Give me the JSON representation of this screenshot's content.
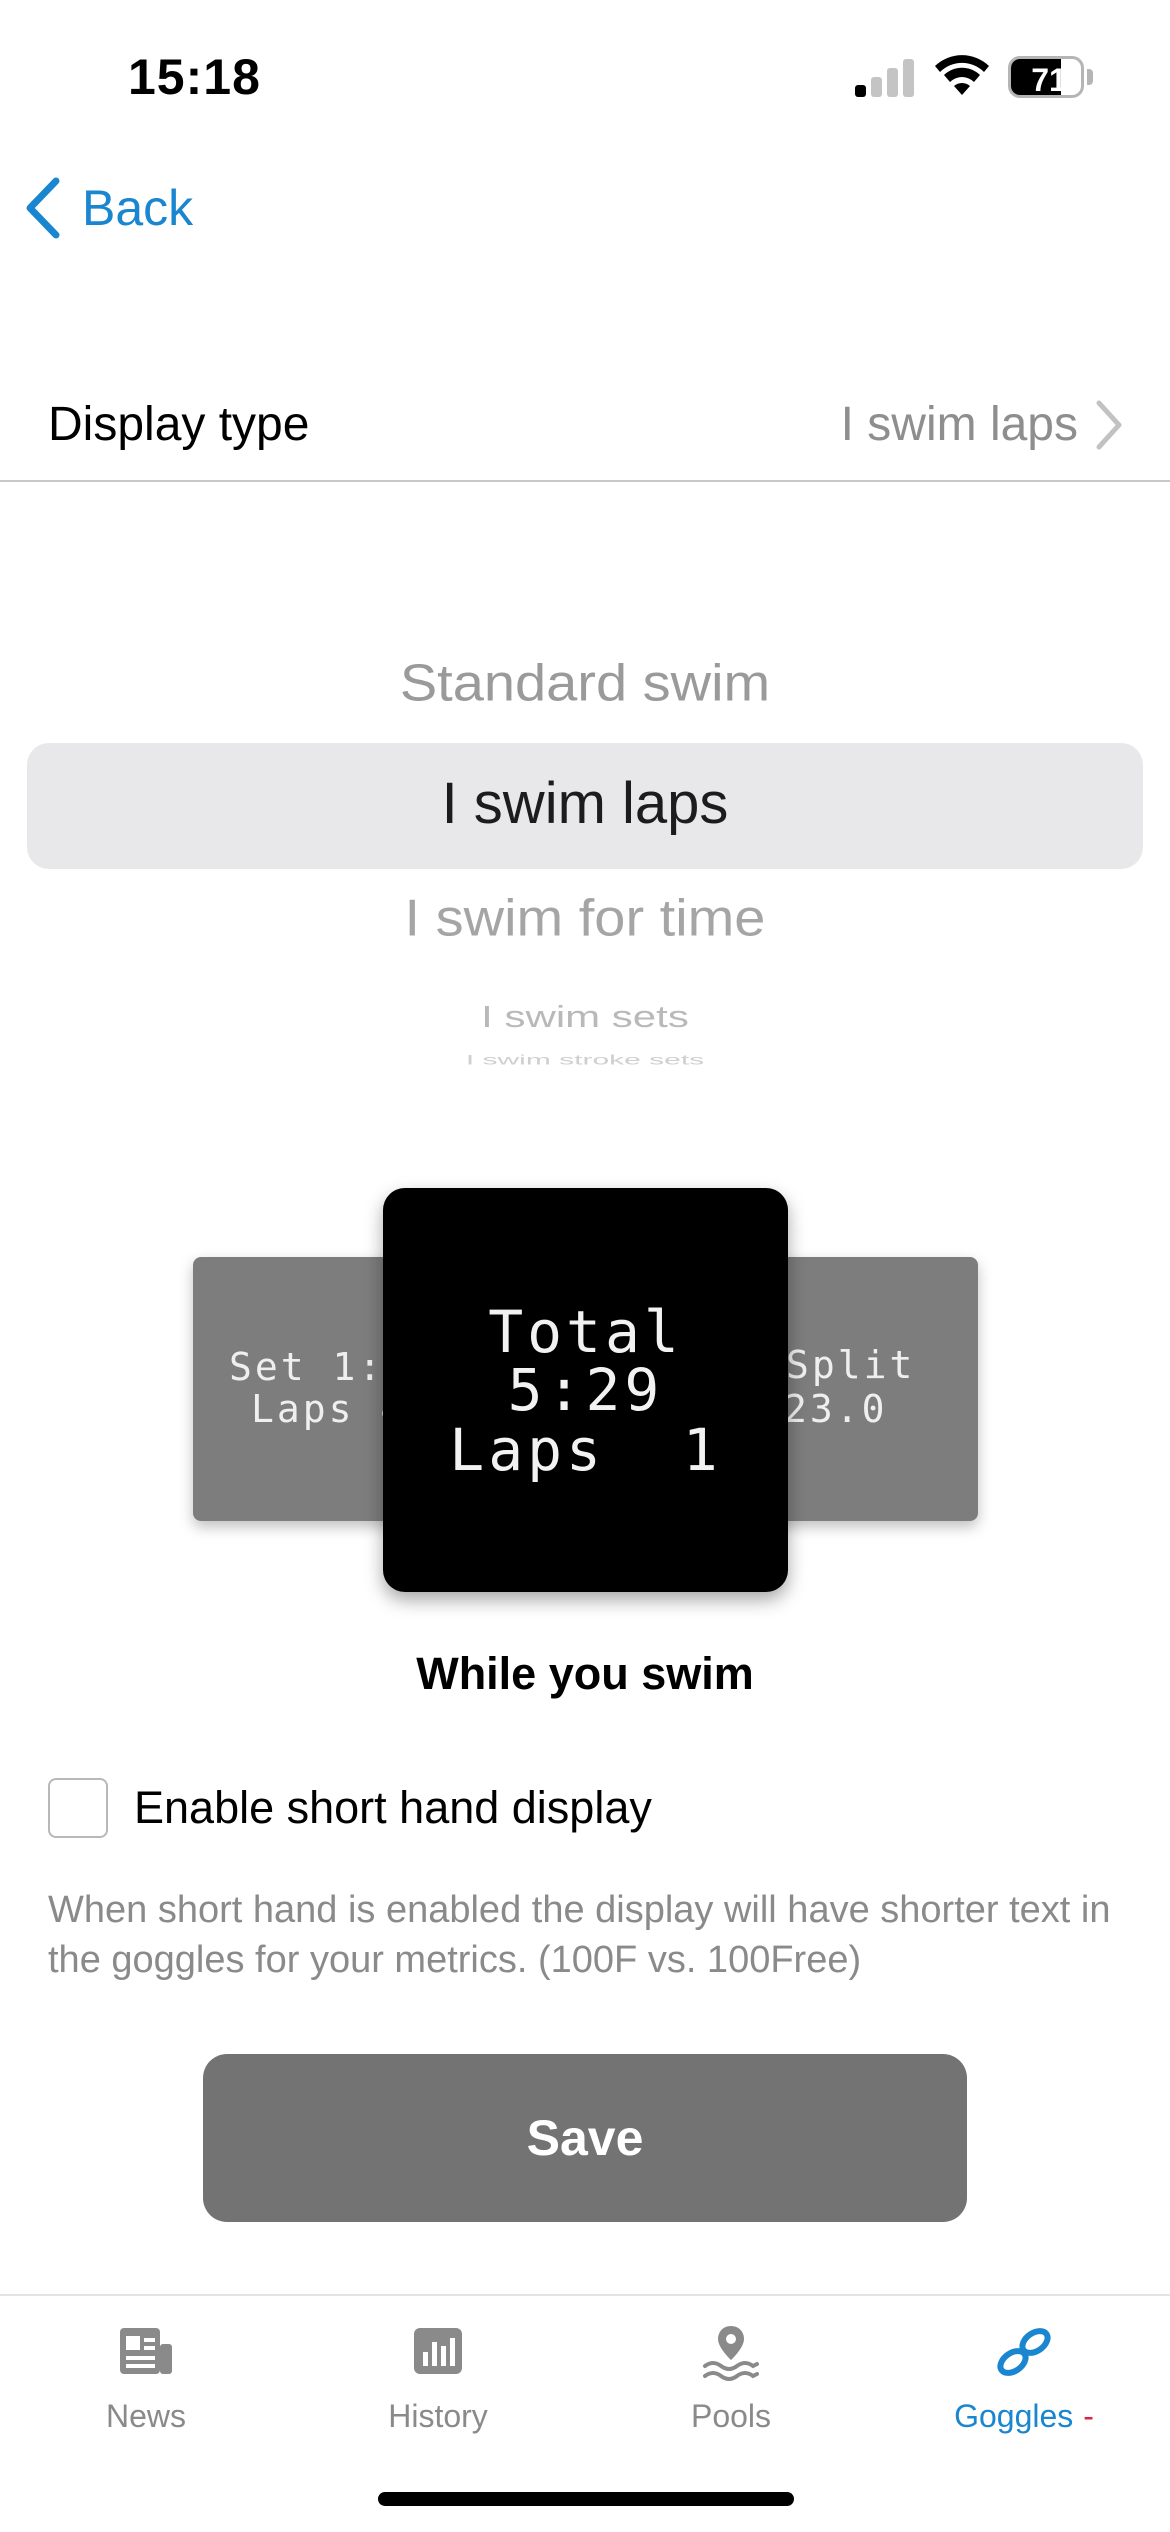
{
  "status_bar": {
    "time": "15:18",
    "battery": "71",
    "battery_level": 0.71
  },
  "nav": {
    "back_label": "Back"
  },
  "settings_row": {
    "label": "Display type",
    "value": "I swim laps"
  },
  "picker": {
    "options": [
      "Standard swim",
      "I swim laps",
      "I swim for time",
      "I swim sets",
      "I swim stroke sets"
    ],
    "selected": "I swim laps"
  },
  "preview": {
    "left_screen": [
      "Set 1:2",
      "Laps 4"
    ],
    "main_screen": [
      "Total",
      "5:29",
      "Laps  1"
    ],
    "right_screen": [
      "Split",
      "23.0"
    ],
    "caption": "While you swim"
  },
  "shorthand": {
    "label": "Enable short hand display",
    "checked": false,
    "description": "When short hand is enabled the display will have shorter text in the goggles for your metrics. (100F vs. 100Free)"
  },
  "save_label": "Save",
  "tabs": [
    {
      "label": "News",
      "icon": "news-icon",
      "active": false
    },
    {
      "label": "History",
      "icon": "chart-icon",
      "active": false
    },
    {
      "label": "Pools",
      "icon": "pool-location-icon",
      "active": false
    },
    {
      "label": "Goggles",
      "icon": "link-icon",
      "active": true,
      "badge": "-"
    }
  ],
  "colors": {
    "accent": "#1a86d0",
    "save_button": "#737373",
    "badge": "#e0224b"
  }
}
